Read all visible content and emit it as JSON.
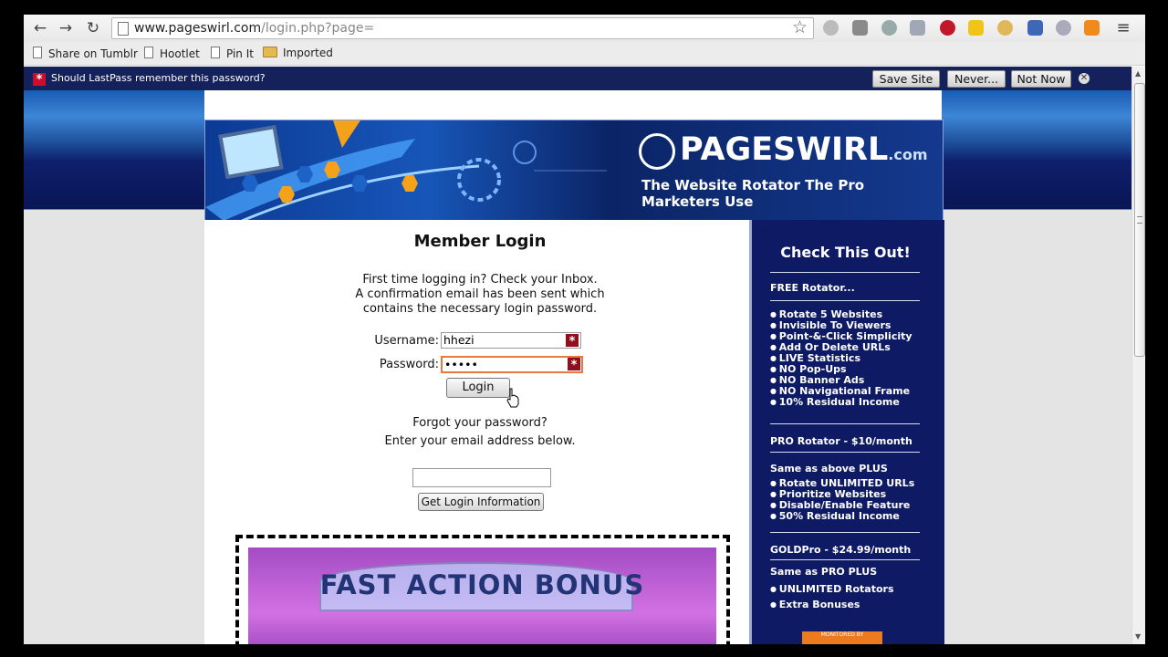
{
  "browser": {
    "url_host": "www.pageswirl.com",
    "url_path": "/login.php?page="
  },
  "bookmarks": [
    {
      "label": "Share on Tumblr",
      "icon": "page-icon"
    },
    {
      "label": "Hootlet",
      "icon": "page-icon"
    },
    {
      "label": "Pin It",
      "icon": "page-icon"
    },
    {
      "label": "Imported",
      "icon": "folder-icon"
    }
  ],
  "lastpass": {
    "prompt": "Should LastPass remember this password?",
    "save_label": "Save Site",
    "never_label": "Never...",
    "notnow_label": "Not Now"
  },
  "header": {
    "brand": "PAGESWIRL",
    "brand_suffix": ".com",
    "tagline": "The Website Rotator The Pro Marketers Use"
  },
  "login": {
    "title": "Member Login",
    "intro_lines": [
      "First time logging in? Check your Inbox.",
      "A confirmation email has been sent which",
      "contains the necessary login password."
    ],
    "username_label": "Username:",
    "username_value": "hhezi",
    "password_label": "Password:",
    "password_value": "•••••",
    "login_button": "Login",
    "forgot_line1": "Forgot your password?",
    "forgot_line2": "Enter your email address below.",
    "get_info_button": "Get Login Information",
    "bonus_text": "FAST ACTION BONUS"
  },
  "sidebar": {
    "title": "Check This Out!",
    "free_heading": "FREE Rotator...",
    "free_features": [
      "Rotate 5 Websites",
      "Invisible To Viewers",
      "Point-&-Click Simplicity",
      "Add Or Delete URLs",
      "LIVE Statistics",
      "NO Pop-Ups",
      "NO Banner Ads",
      "NO Navigational Frame",
      "10% Residual Income"
    ],
    "pro_heading": "PRO Rotator - $10/month",
    "pro_intro": "Same as above PLUS",
    "pro_features": [
      "Rotate UNLIMITED URLs",
      "Prioritize Websites",
      "Disable/Enable Feature",
      "50% Residual Income"
    ],
    "gold_heading": "GOLDPro - $24.99/month",
    "gold_intro": "Same as PRO PLUS",
    "gold_features": [
      "UNLIMITED Rotators",
      "Extra Bonuses"
    ],
    "monitored_text": "MONITORED BY"
  },
  "colors": {
    "lastpass_bar": "#14215a",
    "sidebar_bg": "#0e1a63",
    "password_focus": "#e8793a",
    "lastpass_red": "#8f0f1c"
  }
}
